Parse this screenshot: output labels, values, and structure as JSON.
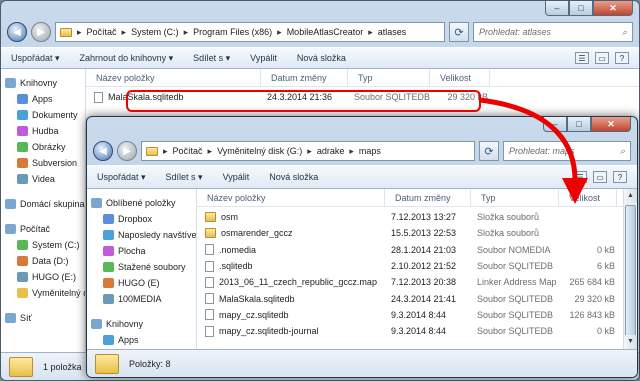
{
  "back_window": {
    "breadcrumb": [
      "Počítač",
      "System (C:)",
      "Program Files (x86)",
      "MobileAtlasCreator",
      "atlases"
    ],
    "search_placeholder": "Prohledat: atlases",
    "toolbar": [
      "Uspořádat ▾",
      "Zahrnout do knihovny ▾",
      "Sdílet s ▾",
      "Vypálit",
      "Nová složka"
    ],
    "columns": [
      "Název položky",
      "Datum změny",
      "Typ",
      "Velikost"
    ],
    "row": {
      "name": "MalaSkala.sqlitedb",
      "date": "24.3.2014 21:36",
      "type": "Soubor SQLITEDB",
      "size": "29 320 kB"
    },
    "sidebar": [
      "Knihovny",
      "Apps",
      "Dokumenty",
      "Hudba",
      "Obrázky",
      "Subversion",
      "Videa",
      "",
      "Domácí skupina",
      "",
      "Počítač",
      "System (C:)",
      "Data (D:)",
      "HUGO (E:)",
      "Vyměnitelný disk",
      "",
      "Síť"
    ],
    "status_text": "1 položka"
  },
  "front_window": {
    "breadcrumb": [
      "Počítač",
      "Vyměnitelný disk (G:)",
      "adrake",
      "maps"
    ],
    "search_placeholder": "Prohledat: maps",
    "toolbar": [
      "Uspořádat ▾",
      "Sdílet s ▾",
      "Vypálit",
      "Nová složka"
    ],
    "columns": [
      "Název položky",
      "Datum změny",
      "Typ",
      "Velikost"
    ],
    "sidebar": [
      "Oblíbené položky",
      "Dropbox",
      "Naposledy navštívené",
      "Plocha",
      "Stažené soubory",
      "HUGO (E)",
      "100MEDIA",
      "",
      "Knihovny",
      "Apps"
    ],
    "rows": [
      {
        "name": "osm",
        "date": "7.12.2013 13:27",
        "type": "Složka souborů",
        "size": "",
        "kind": "folder"
      },
      {
        "name": "osmarender_gccz",
        "date": "15.5.2013 22:53",
        "type": "Složka souborů",
        "size": "",
        "kind": "folder"
      },
      {
        "name": ".nomedia",
        "date": "28.1.2014 21:03",
        "type": "Soubor NOMEDIA",
        "size": "0 kB",
        "kind": "doc"
      },
      {
        "name": ".sqlitedb",
        "date": "2.10.2012 21:52",
        "type": "Soubor SQLITEDB",
        "size": "6 kB",
        "kind": "doc"
      },
      {
        "name": "2013_06_11_czech_republic_gccz.map",
        "date": "7.12.2013 20:38",
        "type": "Linker Address Map",
        "size": "265 684 kB",
        "kind": "doc"
      },
      {
        "name": "MalaSkala.sqlitedb",
        "date": "24.3.2014 21:41",
        "type": "Soubor SQLITEDB",
        "size": "29 320 kB",
        "kind": "doc"
      },
      {
        "name": "mapy_cz.sqlitedb",
        "date": "9.3.2014 8:44",
        "type": "Soubor SQLITEDB",
        "size": "126 843 kB",
        "kind": "doc"
      },
      {
        "name": "mapy_cz.sqlitedb-journal",
        "date": "9.3.2014 8:44",
        "type": "Soubor SQLITEDB",
        "size": "0 kB",
        "kind": "doc"
      }
    ],
    "status_text": "Položky: 8"
  },
  "colors": {
    "highlight": "#e00000",
    "folder": "#e8bf4a",
    "window_chrome": "#b8cce0"
  }
}
